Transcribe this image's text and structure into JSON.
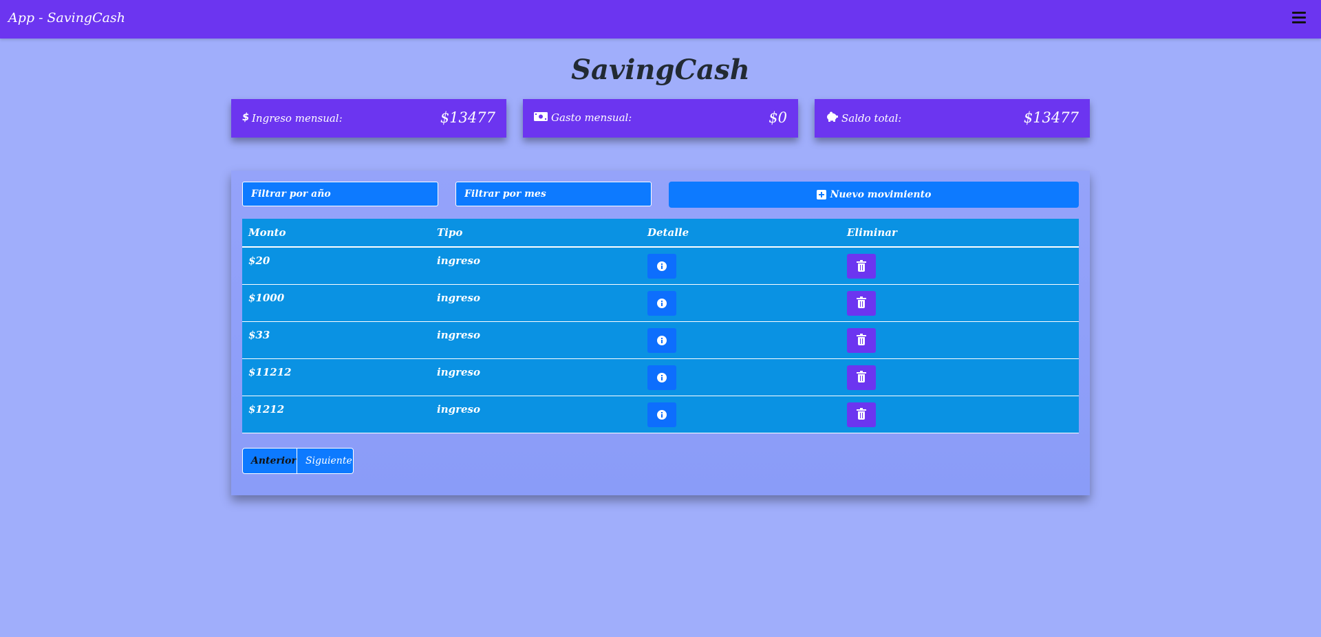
{
  "navbar": {
    "brand": "App - SavingCash",
    "menu_icon": "hamburger-menu-icon"
  },
  "page": {
    "title": "SavingCash"
  },
  "cards": {
    "ingreso": {
      "icon": "dollar-icon",
      "label": "Ingreso mensual:",
      "value": "$13477"
    },
    "gasto": {
      "icon": "money-bill-icon",
      "label": "Gasto mensual:",
      "value": "$0"
    },
    "saldo": {
      "icon": "piggy-bank-icon",
      "label": "Saldo total:",
      "value": "$13477"
    }
  },
  "filters": {
    "year_placeholder": "Filtrar por año",
    "month_placeholder": "Filtrar por mes",
    "new_button_label": "Nuevo movimiento",
    "new_button_icon": "plus-square-icon"
  },
  "table": {
    "headers": [
      "Monto",
      "Tipo",
      "Detalle",
      "Eliminar"
    ],
    "rows": [
      {
        "monto": "$20",
        "tipo": "ingreso"
      },
      {
        "monto": "$1000",
        "tipo": "ingreso"
      },
      {
        "monto": "$33",
        "tipo": "ingreso"
      },
      {
        "monto": "$11212",
        "tipo": "ingreso"
      },
      {
        "monto": "$1212",
        "tipo": "ingreso"
      }
    ],
    "detail_icon": "info-circle-icon",
    "delete_icon": "trash-icon"
  },
  "pagination": {
    "prev": "Anterior",
    "next": "Siguiente"
  },
  "colors": {
    "background": "#a0aefb",
    "navbar": "#6c35f0",
    "card": "#6c35f0",
    "primary_button": "#0d7aff",
    "table_bg": "#0a92e3",
    "delete_button": "#6c35f0"
  }
}
